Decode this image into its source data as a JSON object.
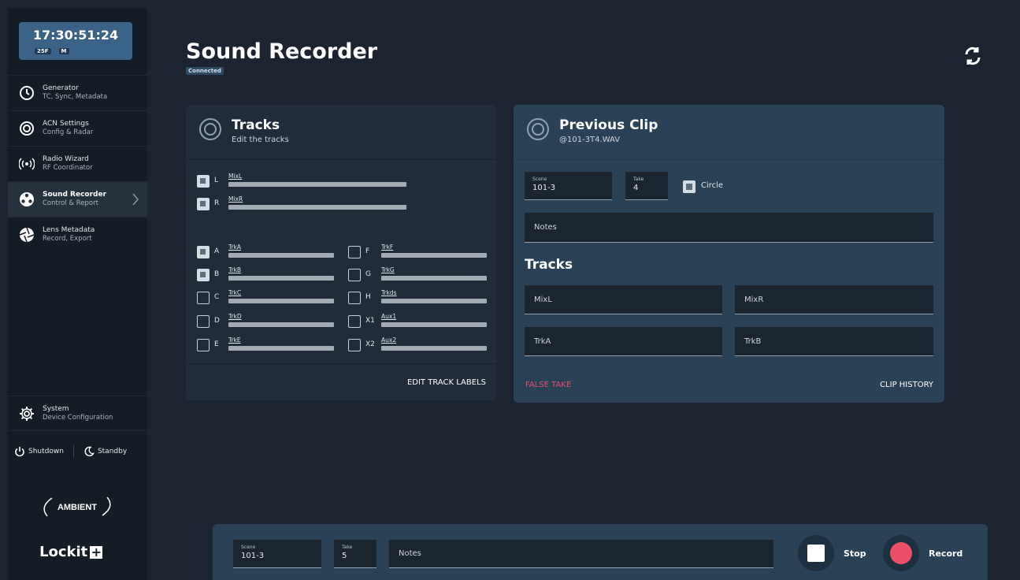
{
  "clock": {
    "time": "17:30:51:24",
    "badges": [
      "25F",
      "M"
    ]
  },
  "sidebar": {
    "items": [
      {
        "title": "Generator",
        "sub": "TC, Sync, Metadata",
        "icon": "clock-icon"
      },
      {
        "title": "ACN Settings",
        "sub": "Config & Radar",
        "icon": "acn-icon"
      },
      {
        "title": "Radio Wizard",
        "sub": "RF Coordinator",
        "icon": "radio-icon"
      },
      {
        "title": "Sound Recorder",
        "sub": "Control & Report",
        "icon": "reel-icon"
      },
      {
        "title": "Lens Metadata",
        "sub": "Record, Export",
        "icon": "aperture-icon"
      }
    ],
    "system": {
      "title": "System",
      "sub": "Device Configuration"
    },
    "shutdown": "Shutdown",
    "standby": "Standby",
    "ambient_logo": "AMBIENT",
    "lockit_logo": "Lockit"
  },
  "header": {
    "title": "Sound Recorder",
    "status": "Connected"
  },
  "tracks_panel": {
    "title": "Tracks",
    "sub": "Edit the tracks",
    "mix": [
      {
        "letter": "L",
        "label": "MixL",
        "checked": true
      },
      {
        "letter": "R",
        "label": "MixR",
        "checked": true
      }
    ],
    "left": [
      {
        "letter": "A",
        "label": "TrkA",
        "checked": true
      },
      {
        "letter": "B",
        "label": "TrkB",
        "checked": true
      },
      {
        "letter": "C",
        "label": "TrkC",
        "checked": false
      },
      {
        "letter": "D",
        "label": "TrkD",
        "checked": false
      },
      {
        "letter": "E",
        "label": "TrkE",
        "checked": false
      }
    ],
    "right": [
      {
        "letter": "F",
        "label": "TrkF",
        "checked": false
      },
      {
        "letter": "G",
        "label": "TrkG",
        "checked": false
      },
      {
        "letter": "H",
        "label": "Trkds",
        "checked": false
      },
      {
        "letter": "X1",
        "label": "Aux1",
        "checked": false
      },
      {
        "letter": "X2",
        "label": "Aux2",
        "checked": false
      }
    ],
    "edit_labels": "EDIT TRACK LABELS"
  },
  "clip_panel": {
    "title": "Previous Clip",
    "sub": "@101-3T4.WAV",
    "scene_label": "Scene",
    "scene": "101-3",
    "take_label": "Take",
    "take": "4",
    "circle": "Circle",
    "notes": "Notes",
    "tracks_title": "Tracks",
    "tracks": [
      "MixL",
      "MixR",
      "TrkA",
      "TrkB"
    ],
    "false_take": "FALSE TAKE",
    "clip_history": "CLIP HISTORY"
  },
  "bottombar": {
    "scene_label": "Scene",
    "scene": "101-3",
    "take_label": "Take",
    "take": "5",
    "notes": "Notes",
    "stop": "Stop",
    "record": "Record"
  }
}
